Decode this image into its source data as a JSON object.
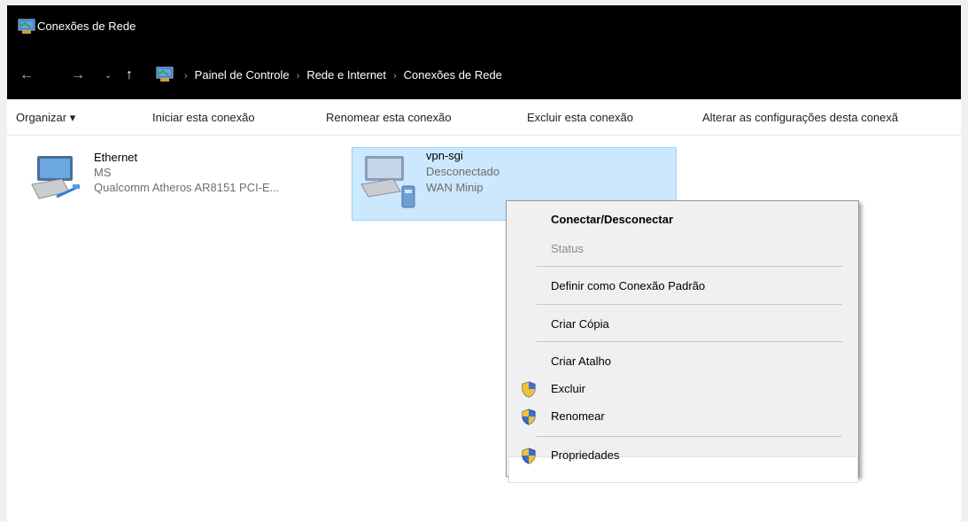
{
  "window": {
    "title": "Conexões de Rede"
  },
  "address": {
    "crumbs": [
      "Painel de Controle",
      "Rede e Internet",
      "Conexões de Rede"
    ],
    "separator": "›"
  },
  "nav_icons": {
    "back": "←",
    "forward": "→",
    "recent": "⌄",
    "up": "↑"
  },
  "toolbar": {
    "organize": "Organizar ▾",
    "start": "Iniciar esta conexão",
    "rename": "Renomear esta conexão",
    "delete": "Excluir esta conexão",
    "change": "Alterar as configurações desta conexã"
  },
  "connections": [
    {
      "name": "Ethernet",
      "status": "MS",
      "device": "Qualcomm Atheros AR8151 PCI-E..."
    },
    {
      "name": "vpn-sgi",
      "status": "Desconectado",
      "device": "WAN Minip"
    }
  ],
  "context_menu": {
    "items": [
      {
        "label": "Conectar/Desconectar",
        "bold": true
      },
      {
        "label": "Status",
        "disabled": true
      },
      {
        "label": "Definir como Conexão Padrão"
      },
      {
        "label": "Criar Cópia"
      },
      {
        "label": "Criar Atalho"
      },
      {
        "label": "Excluir",
        "icon": "uac-shield-icon"
      },
      {
        "label": "Renomear",
        "icon": "uac-shield-icon"
      },
      {
        "label": "Propriedades",
        "icon": "uac-shield-icon",
        "highlighted": true
      }
    ]
  },
  "colors": {
    "titlebar": "#000000",
    "selection": "#cce8ff",
    "selection_border": "#99d1ff",
    "menu_bg": "#f0f0f0"
  }
}
